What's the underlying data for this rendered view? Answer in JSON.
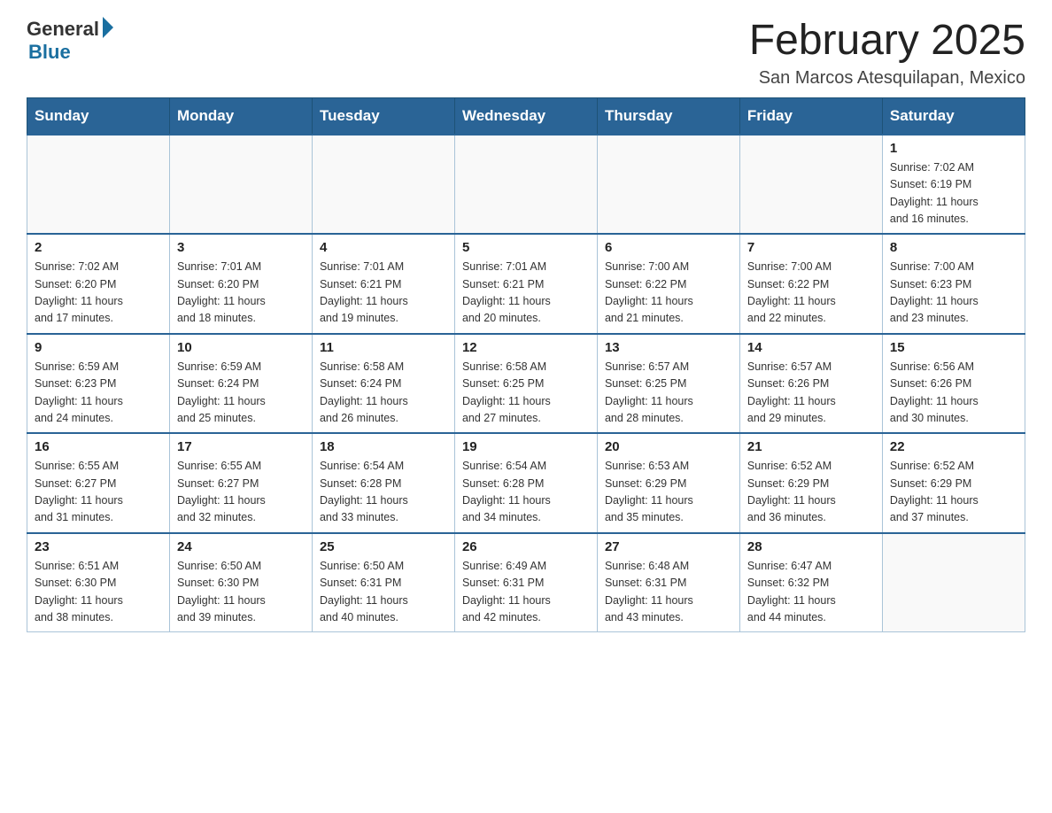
{
  "header": {
    "logo_general": "General",
    "logo_blue": "Blue",
    "month_title": "February 2025",
    "subtitle": "San Marcos Atesquilapan, Mexico"
  },
  "days_of_week": [
    "Sunday",
    "Monday",
    "Tuesday",
    "Wednesday",
    "Thursday",
    "Friday",
    "Saturday"
  ],
  "weeks": [
    [
      {
        "day": "",
        "info": ""
      },
      {
        "day": "",
        "info": ""
      },
      {
        "day": "",
        "info": ""
      },
      {
        "day": "",
        "info": ""
      },
      {
        "day": "",
        "info": ""
      },
      {
        "day": "",
        "info": ""
      },
      {
        "day": "1",
        "info": "Sunrise: 7:02 AM\nSunset: 6:19 PM\nDaylight: 11 hours\nand 16 minutes."
      }
    ],
    [
      {
        "day": "2",
        "info": "Sunrise: 7:02 AM\nSunset: 6:20 PM\nDaylight: 11 hours\nand 17 minutes."
      },
      {
        "day": "3",
        "info": "Sunrise: 7:01 AM\nSunset: 6:20 PM\nDaylight: 11 hours\nand 18 minutes."
      },
      {
        "day": "4",
        "info": "Sunrise: 7:01 AM\nSunset: 6:21 PM\nDaylight: 11 hours\nand 19 minutes."
      },
      {
        "day": "5",
        "info": "Sunrise: 7:01 AM\nSunset: 6:21 PM\nDaylight: 11 hours\nand 20 minutes."
      },
      {
        "day": "6",
        "info": "Sunrise: 7:00 AM\nSunset: 6:22 PM\nDaylight: 11 hours\nand 21 minutes."
      },
      {
        "day": "7",
        "info": "Sunrise: 7:00 AM\nSunset: 6:22 PM\nDaylight: 11 hours\nand 22 minutes."
      },
      {
        "day": "8",
        "info": "Sunrise: 7:00 AM\nSunset: 6:23 PM\nDaylight: 11 hours\nand 23 minutes."
      }
    ],
    [
      {
        "day": "9",
        "info": "Sunrise: 6:59 AM\nSunset: 6:23 PM\nDaylight: 11 hours\nand 24 minutes."
      },
      {
        "day": "10",
        "info": "Sunrise: 6:59 AM\nSunset: 6:24 PM\nDaylight: 11 hours\nand 25 minutes."
      },
      {
        "day": "11",
        "info": "Sunrise: 6:58 AM\nSunset: 6:24 PM\nDaylight: 11 hours\nand 26 minutes."
      },
      {
        "day": "12",
        "info": "Sunrise: 6:58 AM\nSunset: 6:25 PM\nDaylight: 11 hours\nand 27 minutes."
      },
      {
        "day": "13",
        "info": "Sunrise: 6:57 AM\nSunset: 6:25 PM\nDaylight: 11 hours\nand 28 minutes."
      },
      {
        "day": "14",
        "info": "Sunrise: 6:57 AM\nSunset: 6:26 PM\nDaylight: 11 hours\nand 29 minutes."
      },
      {
        "day": "15",
        "info": "Sunrise: 6:56 AM\nSunset: 6:26 PM\nDaylight: 11 hours\nand 30 minutes."
      }
    ],
    [
      {
        "day": "16",
        "info": "Sunrise: 6:55 AM\nSunset: 6:27 PM\nDaylight: 11 hours\nand 31 minutes."
      },
      {
        "day": "17",
        "info": "Sunrise: 6:55 AM\nSunset: 6:27 PM\nDaylight: 11 hours\nand 32 minutes."
      },
      {
        "day": "18",
        "info": "Sunrise: 6:54 AM\nSunset: 6:28 PM\nDaylight: 11 hours\nand 33 minutes."
      },
      {
        "day": "19",
        "info": "Sunrise: 6:54 AM\nSunset: 6:28 PM\nDaylight: 11 hours\nand 34 minutes."
      },
      {
        "day": "20",
        "info": "Sunrise: 6:53 AM\nSunset: 6:29 PM\nDaylight: 11 hours\nand 35 minutes."
      },
      {
        "day": "21",
        "info": "Sunrise: 6:52 AM\nSunset: 6:29 PM\nDaylight: 11 hours\nand 36 minutes."
      },
      {
        "day": "22",
        "info": "Sunrise: 6:52 AM\nSunset: 6:29 PM\nDaylight: 11 hours\nand 37 minutes."
      }
    ],
    [
      {
        "day": "23",
        "info": "Sunrise: 6:51 AM\nSunset: 6:30 PM\nDaylight: 11 hours\nand 38 minutes."
      },
      {
        "day": "24",
        "info": "Sunrise: 6:50 AM\nSunset: 6:30 PM\nDaylight: 11 hours\nand 39 minutes."
      },
      {
        "day": "25",
        "info": "Sunrise: 6:50 AM\nSunset: 6:31 PM\nDaylight: 11 hours\nand 40 minutes."
      },
      {
        "day": "26",
        "info": "Sunrise: 6:49 AM\nSunset: 6:31 PM\nDaylight: 11 hours\nand 42 minutes."
      },
      {
        "day": "27",
        "info": "Sunrise: 6:48 AM\nSunset: 6:31 PM\nDaylight: 11 hours\nand 43 minutes."
      },
      {
        "day": "28",
        "info": "Sunrise: 6:47 AM\nSunset: 6:32 PM\nDaylight: 11 hours\nand 44 minutes."
      },
      {
        "day": "",
        "info": ""
      }
    ]
  ]
}
